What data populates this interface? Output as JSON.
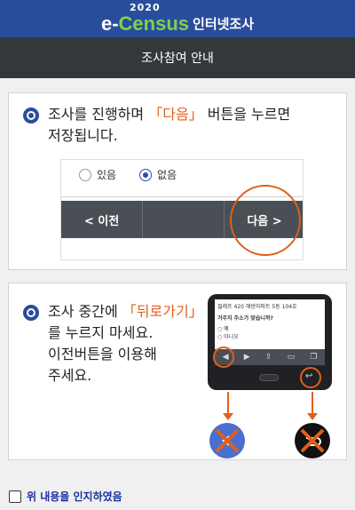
{
  "header": {
    "logo_year": "2020",
    "logo_e": "e-",
    "logo_census": "Census",
    "logo_sub": "인터넷조사",
    "brand_color": "#2a4d9b",
    "accent_green": "#7fd14e"
  },
  "title_bar": {
    "title": "조사참여 안내"
  },
  "card1": {
    "line1_before": "조사를 진행하며 ",
    "line1_highlight": "「다음」",
    "line1_after": " 버튼을 누르면",
    "line2": "저장됩니다.",
    "radio_no": "있음",
    "radio_yes": "없음",
    "prev_button": "< 이전",
    "next_button": "다음 >"
  },
  "card2": {
    "line1_before": "조사 중간에 ",
    "line1_highlight": "「뒤로가기」",
    "line2": "를 누르지 마세요.",
    "line3": "이전버튼을 이용해",
    "line4": "주세요.",
    "phone_text1": "젊레프 420 해방아파트 5동 104호",
    "phone_text2": "거주지 주소가 맞습니까?",
    "phone_opt1": "예",
    "phone_opt2": "아니오"
  },
  "ack": {
    "label": "위 내용을 인지하였음"
  },
  "colors": {
    "highlight": "#e0601a",
    "ack_text": "#1a2ea0"
  }
}
